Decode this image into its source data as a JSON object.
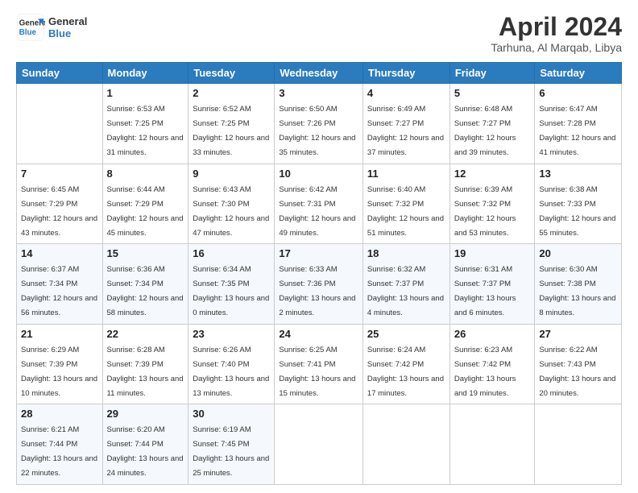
{
  "header": {
    "logo_line1": "General",
    "logo_line2": "Blue",
    "month": "April 2024",
    "location": "Tarhuna, Al Marqab, Libya"
  },
  "columns": [
    "Sunday",
    "Monday",
    "Tuesday",
    "Wednesday",
    "Thursday",
    "Friday",
    "Saturday"
  ],
  "weeks": [
    [
      {
        "day": "",
        "sunrise": "",
        "sunset": "",
        "daylight": ""
      },
      {
        "day": "1",
        "sunrise": "Sunrise: 6:53 AM",
        "sunset": "Sunset: 7:25 PM",
        "daylight": "Daylight: 12 hours and 31 minutes."
      },
      {
        "day": "2",
        "sunrise": "Sunrise: 6:52 AM",
        "sunset": "Sunset: 7:25 PM",
        "daylight": "Daylight: 12 hours and 33 minutes."
      },
      {
        "day": "3",
        "sunrise": "Sunrise: 6:50 AM",
        "sunset": "Sunset: 7:26 PM",
        "daylight": "Daylight: 12 hours and 35 minutes."
      },
      {
        "day": "4",
        "sunrise": "Sunrise: 6:49 AM",
        "sunset": "Sunset: 7:27 PM",
        "daylight": "Daylight: 12 hours and 37 minutes."
      },
      {
        "day": "5",
        "sunrise": "Sunrise: 6:48 AM",
        "sunset": "Sunset: 7:27 PM",
        "daylight": "Daylight: 12 hours and 39 minutes."
      },
      {
        "day": "6",
        "sunrise": "Sunrise: 6:47 AM",
        "sunset": "Sunset: 7:28 PM",
        "daylight": "Daylight: 12 hours and 41 minutes."
      }
    ],
    [
      {
        "day": "7",
        "sunrise": "Sunrise: 6:45 AM",
        "sunset": "Sunset: 7:29 PM",
        "daylight": "Daylight: 12 hours and 43 minutes."
      },
      {
        "day": "8",
        "sunrise": "Sunrise: 6:44 AM",
        "sunset": "Sunset: 7:29 PM",
        "daylight": "Daylight: 12 hours and 45 minutes."
      },
      {
        "day": "9",
        "sunrise": "Sunrise: 6:43 AM",
        "sunset": "Sunset: 7:30 PM",
        "daylight": "Daylight: 12 hours and 47 minutes."
      },
      {
        "day": "10",
        "sunrise": "Sunrise: 6:42 AM",
        "sunset": "Sunset: 7:31 PM",
        "daylight": "Daylight: 12 hours and 49 minutes."
      },
      {
        "day": "11",
        "sunrise": "Sunrise: 6:40 AM",
        "sunset": "Sunset: 7:32 PM",
        "daylight": "Daylight: 12 hours and 51 minutes."
      },
      {
        "day": "12",
        "sunrise": "Sunrise: 6:39 AM",
        "sunset": "Sunset: 7:32 PM",
        "daylight": "Daylight: 12 hours and 53 minutes."
      },
      {
        "day": "13",
        "sunrise": "Sunrise: 6:38 AM",
        "sunset": "Sunset: 7:33 PM",
        "daylight": "Daylight: 12 hours and 55 minutes."
      }
    ],
    [
      {
        "day": "14",
        "sunrise": "Sunrise: 6:37 AM",
        "sunset": "Sunset: 7:34 PM",
        "daylight": "Daylight: 12 hours and 56 minutes."
      },
      {
        "day": "15",
        "sunrise": "Sunrise: 6:36 AM",
        "sunset": "Sunset: 7:34 PM",
        "daylight": "Daylight: 12 hours and 58 minutes."
      },
      {
        "day": "16",
        "sunrise": "Sunrise: 6:34 AM",
        "sunset": "Sunset: 7:35 PM",
        "daylight": "Daylight: 13 hours and 0 minutes."
      },
      {
        "day": "17",
        "sunrise": "Sunrise: 6:33 AM",
        "sunset": "Sunset: 7:36 PM",
        "daylight": "Daylight: 13 hours and 2 minutes."
      },
      {
        "day": "18",
        "sunrise": "Sunrise: 6:32 AM",
        "sunset": "Sunset: 7:37 PM",
        "daylight": "Daylight: 13 hours and 4 minutes."
      },
      {
        "day": "19",
        "sunrise": "Sunrise: 6:31 AM",
        "sunset": "Sunset: 7:37 PM",
        "daylight": "Daylight: 13 hours and 6 minutes."
      },
      {
        "day": "20",
        "sunrise": "Sunrise: 6:30 AM",
        "sunset": "Sunset: 7:38 PM",
        "daylight": "Daylight: 13 hours and 8 minutes."
      }
    ],
    [
      {
        "day": "21",
        "sunrise": "Sunrise: 6:29 AM",
        "sunset": "Sunset: 7:39 PM",
        "daylight": "Daylight: 13 hours and 10 minutes."
      },
      {
        "day": "22",
        "sunrise": "Sunrise: 6:28 AM",
        "sunset": "Sunset: 7:39 PM",
        "daylight": "Daylight: 13 hours and 11 minutes."
      },
      {
        "day": "23",
        "sunrise": "Sunrise: 6:26 AM",
        "sunset": "Sunset: 7:40 PM",
        "daylight": "Daylight: 13 hours and 13 minutes."
      },
      {
        "day": "24",
        "sunrise": "Sunrise: 6:25 AM",
        "sunset": "Sunset: 7:41 PM",
        "daylight": "Daylight: 13 hours and 15 minutes."
      },
      {
        "day": "25",
        "sunrise": "Sunrise: 6:24 AM",
        "sunset": "Sunset: 7:42 PM",
        "daylight": "Daylight: 13 hours and 17 minutes."
      },
      {
        "day": "26",
        "sunrise": "Sunrise: 6:23 AM",
        "sunset": "Sunset: 7:42 PM",
        "daylight": "Daylight: 13 hours and 19 minutes."
      },
      {
        "day": "27",
        "sunrise": "Sunrise: 6:22 AM",
        "sunset": "Sunset: 7:43 PM",
        "daylight": "Daylight: 13 hours and 20 minutes."
      }
    ],
    [
      {
        "day": "28",
        "sunrise": "Sunrise: 6:21 AM",
        "sunset": "Sunset: 7:44 PM",
        "daylight": "Daylight: 13 hours and 22 minutes."
      },
      {
        "day": "29",
        "sunrise": "Sunrise: 6:20 AM",
        "sunset": "Sunset: 7:44 PM",
        "daylight": "Daylight: 13 hours and 24 minutes."
      },
      {
        "day": "30",
        "sunrise": "Sunrise: 6:19 AM",
        "sunset": "Sunset: 7:45 PM",
        "daylight": "Daylight: 13 hours and 25 minutes."
      },
      {
        "day": "",
        "sunrise": "",
        "sunset": "",
        "daylight": ""
      },
      {
        "day": "",
        "sunrise": "",
        "sunset": "",
        "daylight": ""
      },
      {
        "day": "",
        "sunrise": "",
        "sunset": "",
        "daylight": ""
      },
      {
        "day": "",
        "sunrise": "",
        "sunset": "",
        "daylight": ""
      }
    ]
  ]
}
